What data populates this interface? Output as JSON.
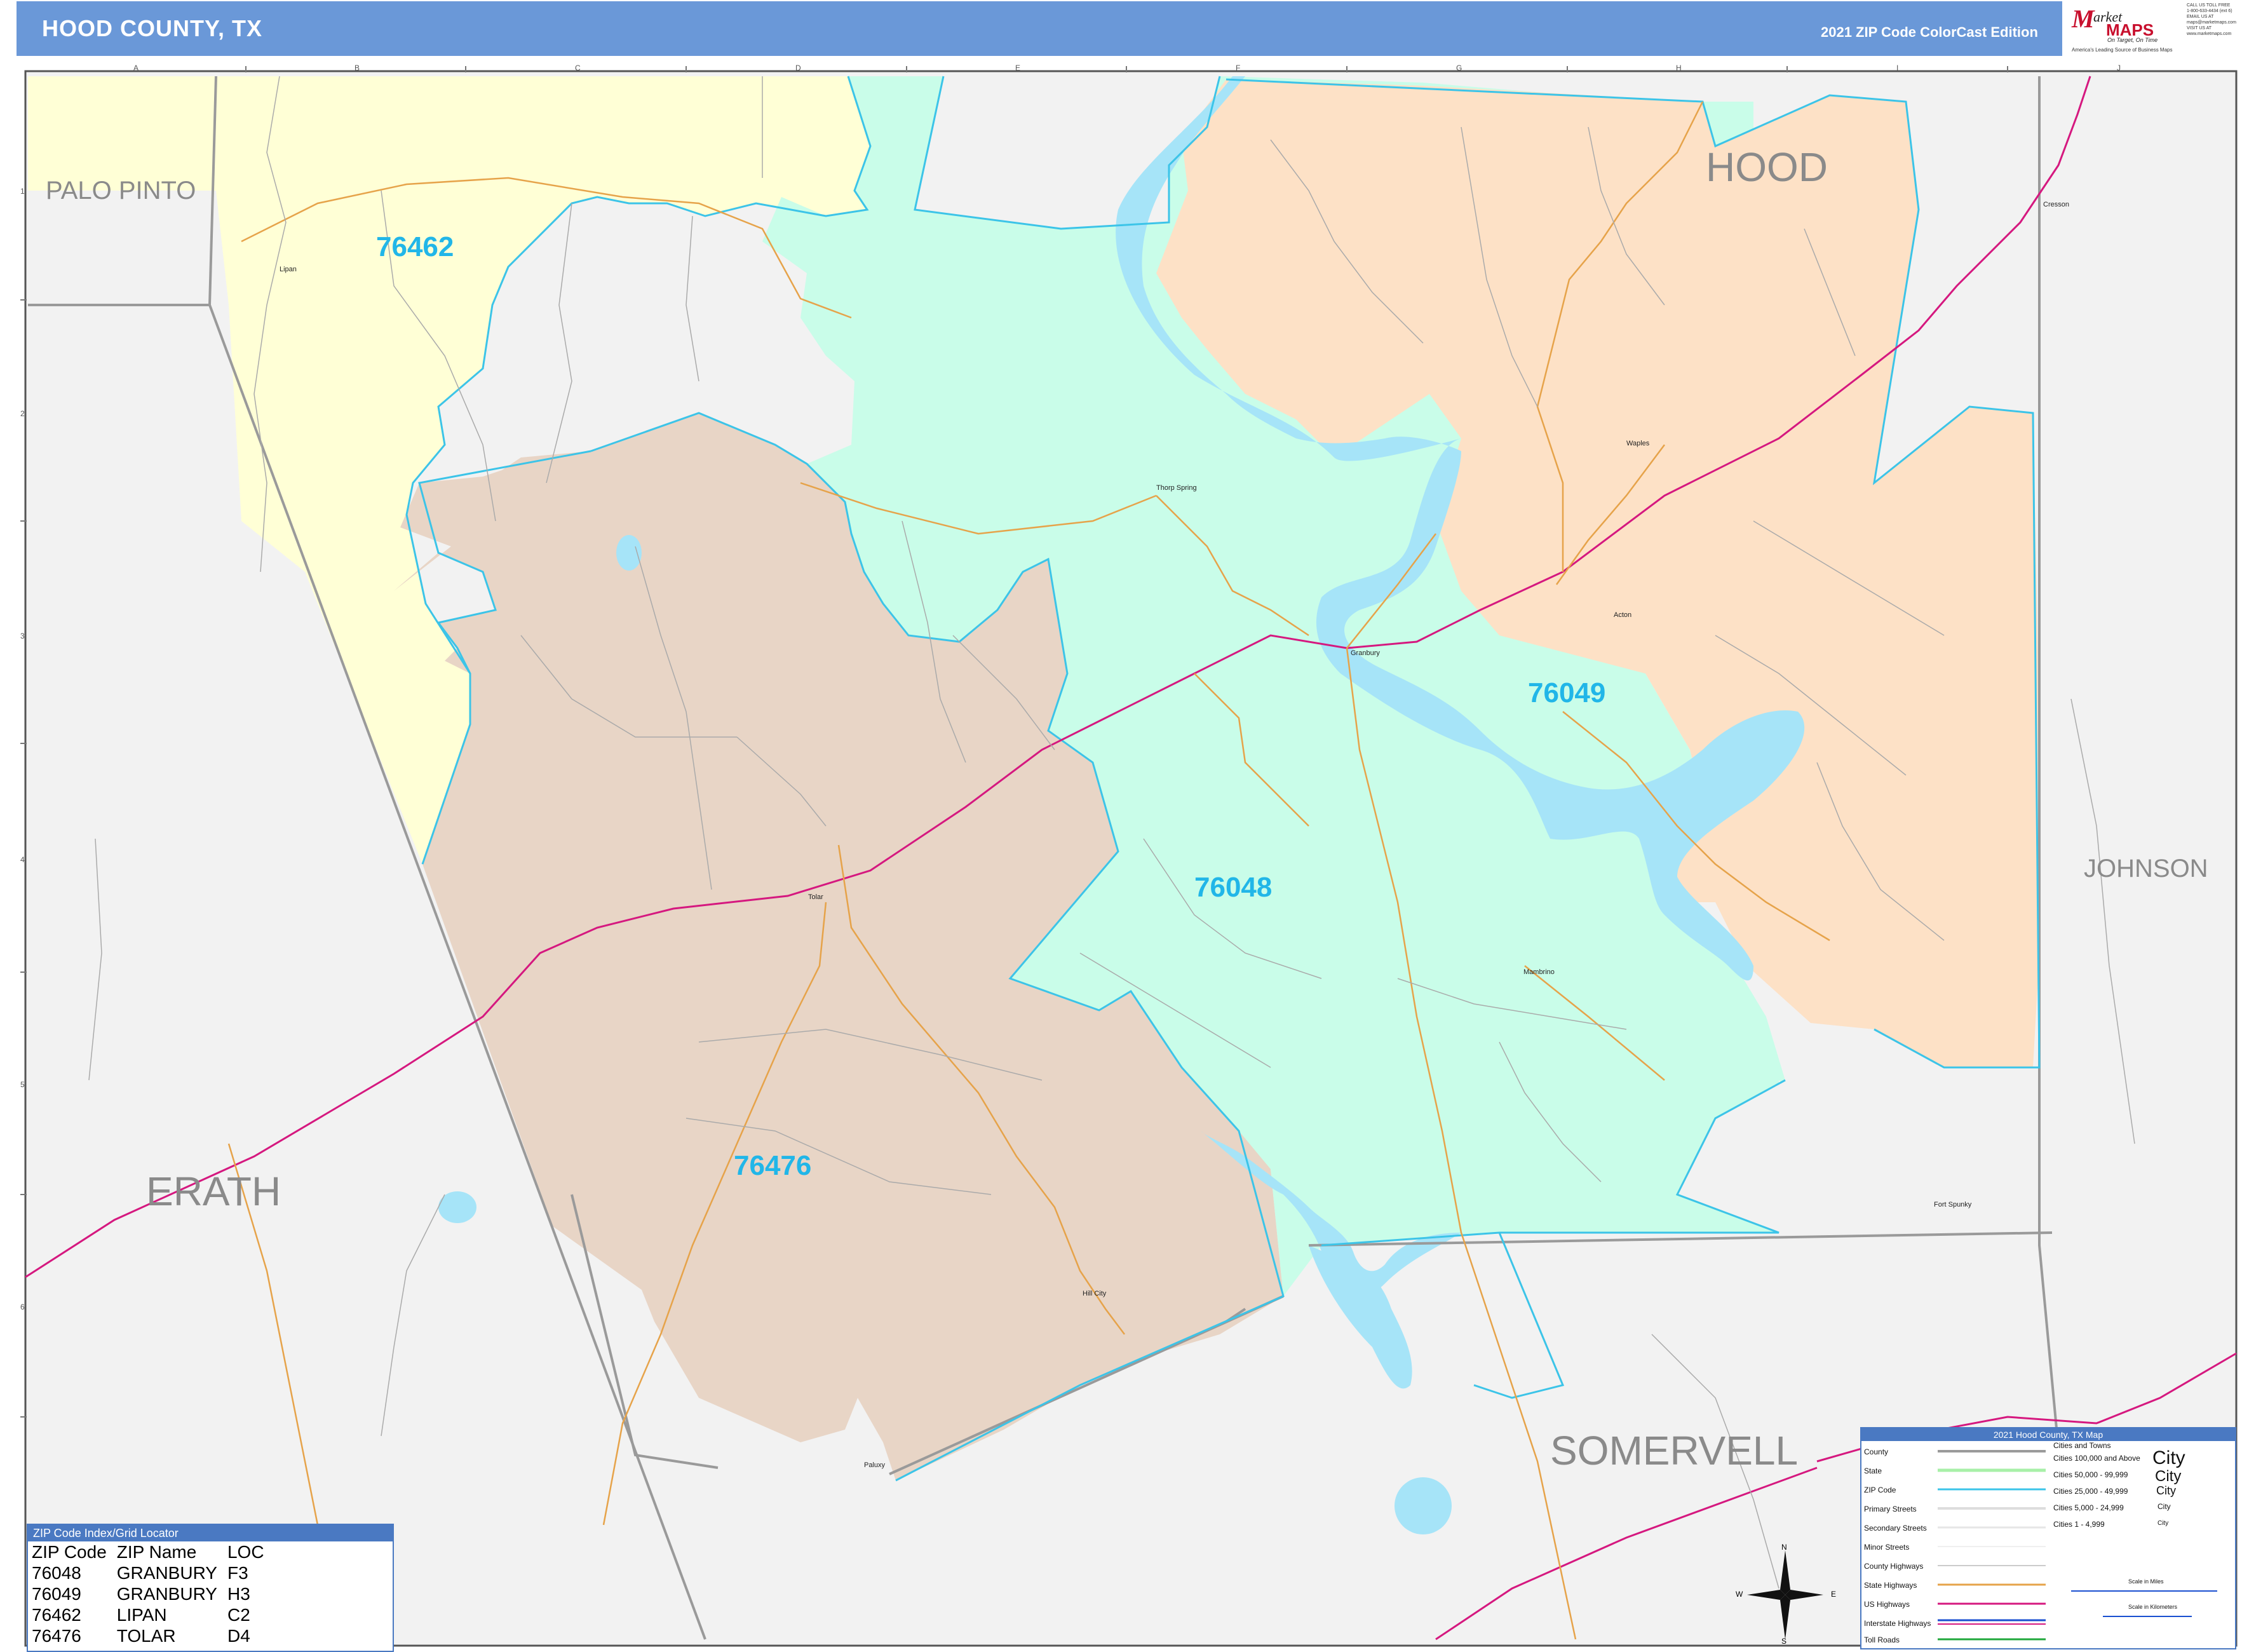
{
  "header": {
    "title": "HOOD COUNTY, TX",
    "edition": "2021 ZIP Code ColorCast Edition"
  },
  "logo": {
    "brand_m": "M",
    "brand_top": "arket",
    "brand_maps": "MAPS",
    "tagline": "America's Leading Source of Business Maps",
    "slogan": "On Target, On Time"
  },
  "contact": [
    "CALL US TOLL FREE",
    "1-800-633-4434 (ext 6)",
    "EMAIL US AT",
    "maps@marketmaps.com",
    "VISIT US AT",
    "www.marketmaps.com"
  ],
  "colors": {
    "zip_76462": "#ffffd6",
    "zip_76048": "#c9fde9",
    "zip_76049": "#fde1c6",
    "zip_76476": "#e8d5c6",
    "outside": "#f2f2f2",
    "water": "#a6e4f8",
    "zip_boundary": "#3cc4e8",
    "county_boundary": "#9a9a9a",
    "us_highway": "#d5187f",
    "state_highway": "#e6a34a",
    "header": "#6a98d8"
  },
  "zip_labels": [
    {
      "zip": "76462",
      "name": "LIPAN"
    },
    {
      "zip": "76049",
      "name": "GRANBURY"
    },
    {
      "zip": "76048",
      "name": "GRANBURY"
    },
    {
      "zip": "76476",
      "name": "TOLAR"
    }
  ],
  "county_labels": [
    "PALO PINTO",
    "HOOD",
    "JOHNSON",
    "ERATH",
    "SOMERVELL"
  ],
  "towns": [
    "Lipan",
    "Thorp Spring",
    "Granbury",
    "Waples",
    "Cresson",
    "Acton",
    "Tolar",
    "Mambrino",
    "Fort Spunky",
    "Hill City",
    "Paluxy"
  ],
  "grid": {
    "columns": [
      "A",
      "B",
      "C",
      "D",
      "E",
      "F",
      "G",
      "H",
      "I",
      "J"
    ],
    "rows": [
      "1",
      "2",
      "3",
      "4",
      "5",
      "6"
    ]
  },
  "locator": {
    "title": "ZIP Code Index/Grid Locator",
    "headers": [
      "ZIP Code",
      "ZIP Name",
      "LOC"
    ],
    "rows": [
      [
        "76048",
        "GRANBURY",
        "F3"
      ],
      [
        "76049",
        "GRANBURY",
        "H3"
      ],
      [
        "76462",
        "LIPAN",
        "C2"
      ],
      [
        "76476",
        "TOLAR",
        "D4"
      ]
    ]
  },
  "legend": {
    "title": "2021 Hood County, TX Map",
    "items": [
      "County",
      "State",
      "ZIP Code",
      "Primary Streets",
      "Secondary Streets",
      "Minor Streets",
      "County Highways",
      "State Highways",
      "US Highways",
      "Interstate Highways",
      "Toll Roads"
    ],
    "cities_header": "Cities and Towns",
    "city_sizes": [
      "Cities 100,000 and Above",
      "Cities 50,000 - 99,999",
      "Cities 25,000 - 49,999",
      "Cities 5,000 - 24,999",
      "Cities 1 - 4,999"
    ],
    "city_samples": [
      "City",
      "City",
      "City",
      "City",
      "City"
    ],
    "scale_miles": "Scale in Miles",
    "scale_km": "Scale in Kilometers"
  },
  "compass": [
    "N",
    "S",
    "E",
    "W"
  ]
}
